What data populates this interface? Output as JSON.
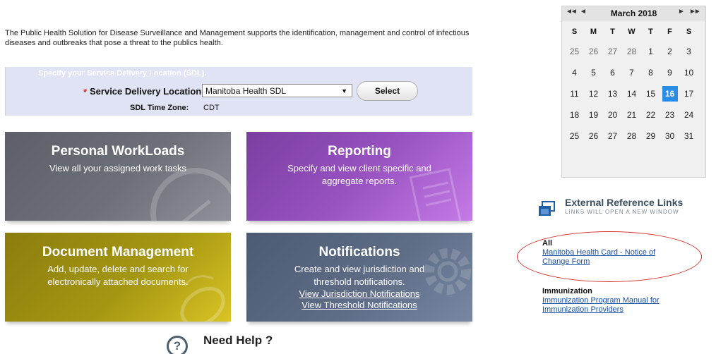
{
  "intro": "The Public Health Solution for Disease Surveillance and Management supports the identification, management and control of infectious diseases and outbreaks that pose a threat to the publics health.",
  "sdl": {
    "header": "Specify your Service Delivery Location (SDL).",
    "required_mark": "*",
    "label": "Service Delivery Location:",
    "selected": "Manitoba Health SDL",
    "button": "Select",
    "timezone_label": "SDL Time Zone:",
    "timezone_value": "CDT"
  },
  "tiles": {
    "workloads": {
      "title": "Personal WorkLoads",
      "desc": "View all your assigned work tasks"
    },
    "reporting": {
      "title": "Reporting",
      "desc": "Specify and view client specific and aggregate reports."
    },
    "docs": {
      "title": "Document Management",
      "desc": "Add, update, delete and search for electronically attached documents."
    },
    "notifications": {
      "title": "Notifications",
      "desc": "Create and view jurisdiction and threshold notifications.",
      "link1": "View Jurisdiction Notifications",
      "link2": "View Threshold Notifications"
    }
  },
  "help": {
    "icon_text": "?",
    "title": "Need Help ?"
  },
  "calendar": {
    "title": "March 2018",
    "prev_year": "◄◄",
    "prev_month": "◄",
    "next_month": "►",
    "next_year": "►►",
    "weekdays": [
      "S",
      "M",
      "T",
      "W",
      "T",
      "F",
      "S"
    ],
    "weeks": [
      [
        "25",
        "26",
        "27",
        "28",
        "1",
        "2",
        "3"
      ],
      [
        "4",
        "5",
        "6",
        "7",
        "8",
        "9",
        "10"
      ],
      [
        "11",
        "12",
        "13",
        "14",
        "15",
        "16",
        "17"
      ],
      [
        "18",
        "19",
        "20",
        "21",
        "22",
        "23",
        "24"
      ],
      [
        "25",
        "26",
        "27",
        "28",
        "29",
        "30",
        "31"
      ]
    ],
    "today": "16",
    "highlight_color": "#2b8ee6"
  },
  "external_links": {
    "title": "External Reference Links",
    "subtitle": "LINKS WILL OPEN A NEW WINDOW",
    "groups": [
      {
        "title": "All",
        "link": "Manitoba Health Card - Notice of Change Form"
      },
      {
        "title": "Immunization",
        "link": "Immunization Program Manual for Immunization Providers"
      }
    ]
  },
  "colors": {
    "workloads": "#6e7079",
    "reporting": "#9752c0",
    "docs": "#a59612",
    "notifications": "#5e6c86",
    "annotation_circle": "#d42c24"
  }
}
